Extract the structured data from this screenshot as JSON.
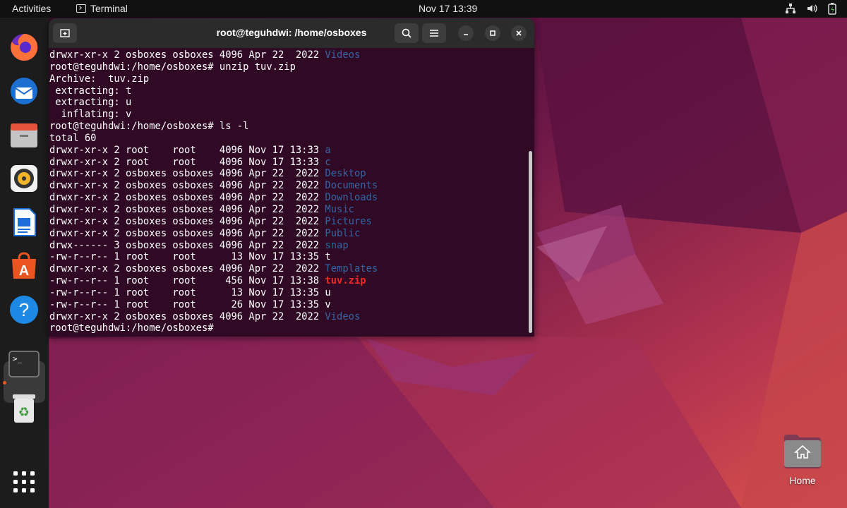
{
  "topbar": {
    "activities": "Activities",
    "app_name": "Terminal",
    "clock": "Nov 17  13:39",
    "tray_icons": [
      "network-icon",
      "volume-icon",
      "battery-icon"
    ]
  },
  "dock": {
    "items": [
      "firefox-icon",
      "thunderbird-icon",
      "files-icon",
      "rhythmbox-icon",
      "writer-icon",
      "software-icon",
      "help-icon",
      "terminal-icon",
      "trash-icon",
      "app-grid-icon"
    ]
  },
  "terminal": {
    "title": "root@teguhdwi: /home/osboxes",
    "lines": [
      [
        {
          "t": "drwxr-xr-x 2 osboxes osboxes 4096 Apr 22  2022 "
        },
        {
          "t": "Videos",
          "c": "blue"
        }
      ],
      [
        {
          "t": "root@teguhdwi:/home/osboxes# unzip tuv.zip"
        }
      ],
      [
        {
          "t": "Archive:  tuv.zip"
        }
      ],
      [
        {
          "t": " extracting: t"
        }
      ],
      [
        {
          "t": " extracting: u"
        }
      ],
      [
        {
          "t": "  inflating: v"
        }
      ],
      [
        {
          "t": "root@teguhdwi:/home/osboxes# ls -l"
        }
      ],
      [
        {
          "t": "total 60"
        }
      ],
      [
        {
          "t": "drwxr-xr-x 2 root    root    4096 Nov 17 13:33 "
        },
        {
          "t": "a",
          "c": "blue"
        }
      ],
      [
        {
          "t": "drwxr-xr-x 2 root    root    4096 Nov 17 13:33 "
        },
        {
          "t": "c",
          "c": "blue"
        }
      ],
      [
        {
          "t": "drwxr-xr-x 2 osboxes osboxes 4096 Apr 22  2022 "
        },
        {
          "t": "Desktop",
          "c": "blue"
        }
      ],
      [
        {
          "t": "drwxr-xr-x 2 osboxes osboxes 4096 Apr 22  2022 "
        },
        {
          "t": "Documents",
          "c": "blue"
        }
      ],
      [
        {
          "t": "drwxr-xr-x 2 osboxes osboxes 4096 Apr 22  2022 "
        },
        {
          "t": "Downloads",
          "c": "blue"
        }
      ],
      [
        {
          "t": "drwxr-xr-x 2 osboxes osboxes 4096 Apr 22  2022 "
        },
        {
          "t": "Music",
          "c": "blue"
        }
      ],
      [
        {
          "t": "drwxr-xr-x 2 osboxes osboxes 4096 Apr 22  2022 "
        },
        {
          "t": "Pictures",
          "c": "blue"
        }
      ],
      [
        {
          "t": "drwxr-xr-x 2 osboxes osboxes 4096 Apr 22  2022 "
        },
        {
          "t": "Public",
          "c": "blue"
        }
      ],
      [
        {
          "t": "drwx------ 3 osboxes osboxes 4096 Apr 22  2022 "
        },
        {
          "t": "snap",
          "c": "blue"
        }
      ],
      [
        {
          "t": "-rw-r--r-- 1 root    root      13 Nov 17 13:35 t"
        }
      ],
      [
        {
          "t": "drwxr-xr-x 2 osboxes osboxes 4096 Apr 22  2022 "
        },
        {
          "t": "Templates",
          "c": "blue"
        }
      ],
      [
        {
          "t": "-rw-r--r-- 1 root    root     456 Nov 17 13:38 "
        },
        {
          "t": "tuv.zip",
          "c": "red"
        }
      ],
      [
        {
          "t": "-rw-r--r-- 1 root    root      13 Nov 17 13:35 u"
        }
      ],
      [
        {
          "t": "-rw-r--r-- 1 root    root      26 Nov 17 13:35 v"
        }
      ],
      [
        {
          "t": "drwxr-xr-x 2 osboxes osboxes 4096 Apr 22  2022 "
        },
        {
          "t": "Videos",
          "c": "blue"
        }
      ],
      [
        {
          "t": "root@teguhdwi:/home/osboxes# "
        }
      ]
    ]
  },
  "desktop": {
    "home_label": "Home"
  },
  "colors": {
    "terminal_bg": "#300a24",
    "dir_blue": "#3465a4",
    "archive_red": "#ef2929",
    "accent_orange": "#e95420"
  }
}
